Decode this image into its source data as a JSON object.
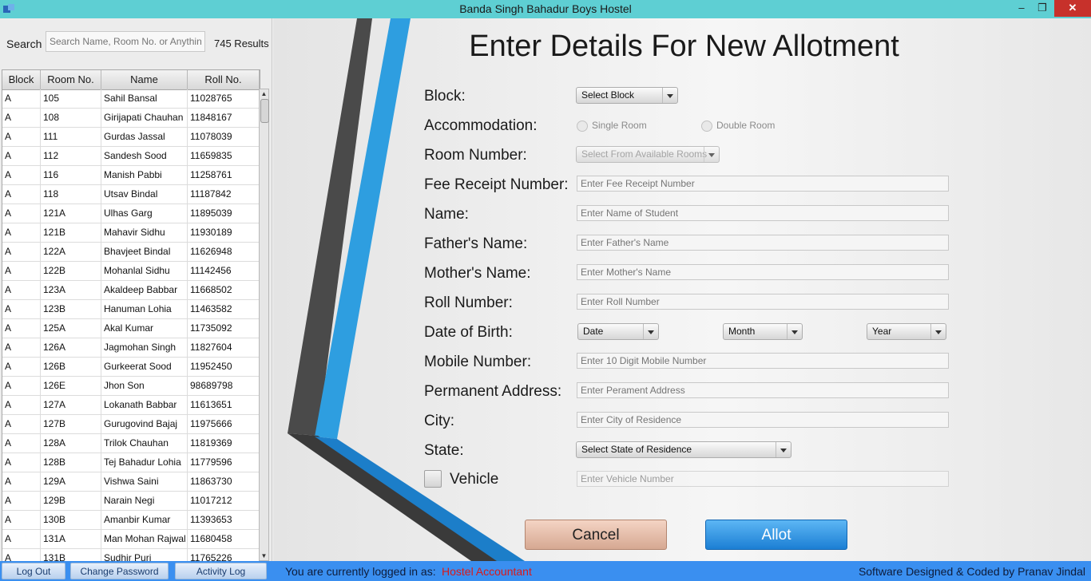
{
  "window": {
    "title": "Banda Singh Bahadur Boys Hostel",
    "minimize": "–",
    "restore": "❐",
    "close": "✕"
  },
  "sidebar": {
    "search_label": "Search",
    "search_placeholder": "Search Name, Room No. or Anything",
    "result_count": "745 Results",
    "columns": [
      "Block",
      "Room No.",
      "Name",
      "Roll No."
    ],
    "rows": [
      [
        "A",
        "105",
        "Sahil Bansal",
        "11028765"
      ],
      [
        "A",
        "108",
        "Girijapati Chauhan",
        "11848167"
      ],
      [
        "A",
        "111",
        "Gurdas Jassal",
        "11078039"
      ],
      [
        "A",
        "112",
        "Sandesh Sood",
        "11659835"
      ],
      [
        "A",
        "116",
        "Manish Pabbi",
        "11258761"
      ],
      [
        "A",
        "118",
        "Utsav Bindal",
        "11187842"
      ],
      [
        "A",
        "121A",
        "Ulhas Garg",
        "11895039"
      ],
      [
        "A",
        "121B",
        "Mahavir Sidhu",
        "11930189"
      ],
      [
        "A",
        "122A",
        "Bhavjeet Bindal",
        "11626948"
      ],
      [
        "A",
        "122B",
        "Mohanlal Sidhu",
        "11142456"
      ],
      [
        "A",
        "123A",
        "Akaldeep Babbar",
        "11668502"
      ],
      [
        "A",
        "123B",
        "Hanuman Lohia",
        "11463582"
      ],
      [
        "A",
        "125A",
        "Akal Kumar",
        "11735092"
      ],
      [
        "A",
        "126A",
        "Jagmohan Singh",
        "11827604"
      ],
      [
        "A",
        "126B",
        "Gurkeerat Sood",
        "11952450"
      ],
      [
        "A",
        "126E",
        "Jhon Son",
        "98689798"
      ],
      [
        "A",
        "127A",
        "Lokanath Babbar",
        "11613651"
      ],
      [
        "A",
        "127B",
        "Gurugovind Bajaj",
        "11975666"
      ],
      [
        "A",
        "128A",
        "Trilok Chauhan",
        "11819369"
      ],
      [
        "A",
        "128B",
        "Tej Bahadur Lohia",
        "11779596"
      ],
      [
        "A",
        "129A",
        "Vishwa Saini",
        "11863730"
      ],
      [
        "A",
        "129B",
        "Narain Negi",
        "11017212"
      ],
      [
        "A",
        "130B",
        "Amanbir Kumar",
        "11393653"
      ],
      [
        "A",
        "131A",
        "Man Mohan Rajwal",
        "11680458"
      ],
      [
        "A",
        "131B",
        "Sudhir Puri",
        "11765226"
      ]
    ]
  },
  "form": {
    "heading": "Enter Details For New Allotment",
    "block_label": "Block:",
    "block_select": "Select Block",
    "accommodation_label": "Accommodation:",
    "single_room": "Single Room",
    "double_room": "Double Room",
    "room_number_label": "Room Number:",
    "room_select": "Select From Available Rooms",
    "fee_receipt_label": "Fee Receipt Number:",
    "fee_receipt_placeholder": "Enter Fee Receipt Number",
    "name_label": "Name:",
    "name_placeholder": "Enter Name of Student",
    "father_label": "Father's Name:",
    "father_placeholder": "Enter Father's Name",
    "mother_label": "Mother's Name:",
    "mother_placeholder": "Enter Mother's Name",
    "roll_label": "Roll Number:",
    "roll_placeholder": "Enter Roll Number",
    "dob_label": "Date of Birth:",
    "dob_date": "Date",
    "dob_month": "Month",
    "dob_year": "Year",
    "mobile_label": "Mobile Number:",
    "mobile_placeholder": "Enter 10 Digit Mobile Number",
    "address_label": "Permanent Address:",
    "address_placeholder": "Enter Perament Address",
    "city_label": "City:",
    "city_placeholder": "Enter City of Residence",
    "state_label": "State:",
    "state_select": "Select State of Residence",
    "vehicle_label": "Vehicle",
    "vehicle_placeholder": "Enter Vehicle Number",
    "cancel": "Cancel",
    "allot": "Allot"
  },
  "statusbar": {
    "logout": "Log Out",
    "change_password": "Change Password",
    "activity_log": "Activity Log",
    "logged_in_label": "You are currently logged in as:",
    "role": "Hostel Accountant",
    "credit": "Software Designed & Coded by Pranav Jindal"
  }
}
